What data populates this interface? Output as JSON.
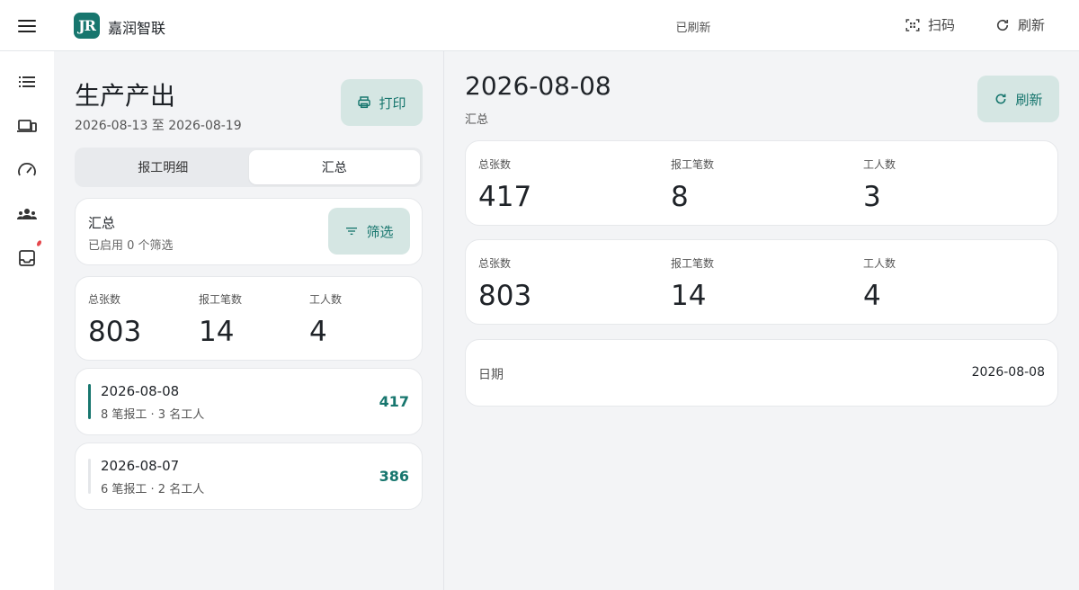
{
  "topbar": {
    "brand": "嘉润智联",
    "logo_text": "JR",
    "status": "已刷新",
    "scan_label": "扫码",
    "refresh_label": "刷新",
    "accent": "#17766e"
  },
  "sidebar": {
    "items": [
      {
        "icon": "list-icon"
      },
      {
        "icon": "devices-icon"
      },
      {
        "icon": "speedometer-icon"
      },
      {
        "icon": "groups-icon"
      },
      {
        "icon": "inbox-icon"
      }
    ]
  },
  "left": {
    "title": "生产产出",
    "date_range": "2026-08-13 至 2026-08-19",
    "print_label": "打印",
    "tabs": [
      {
        "label": "报工明细",
        "active": false
      },
      {
        "label": "汇总",
        "active": true
      }
    ],
    "filter": {
      "title": "汇总",
      "subtitle": "已启用 0 个筛选",
      "button_label": "筛选"
    },
    "stats": [
      {
        "label": "总张数",
        "value": "803"
      },
      {
        "label": "报工笔数",
        "value": "14"
      },
      {
        "label": "工人数",
        "value": "4"
      }
    ],
    "days": [
      {
        "date": "2026-08-08",
        "subtitle": "8 笔报工 · 3 名工人",
        "value": "417",
        "selected": true
      },
      {
        "date": "2026-08-07",
        "subtitle": "6 笔报工 · 2 名工人",
        "value": "386",
        "selected": false
      }
    ]
  },
  "right": {
    "title": "2026-08-08",
    "subtitle": "汇总",
    "refresh_label": "刷新",
    "day_stats": [
      {
        "label": "总张数",
        "value": "417"
      },
      {
        "label": "报工笔数",
        "value": "8"
      },
      {
        "label": "工人数",
        "value": "3"
      }
    ],
    "total_stats": [
      {
        "label": "总张数",
        "value": "803"
      },
      {
        "label": "报工笔数",
        "value": "14"
      },
      {
        "label": "工人数",
        "value": "4"
      }
    ],
    "date_row": {
      "label": "日期",
      "value": "2026-08-08"
    }
  }
}
